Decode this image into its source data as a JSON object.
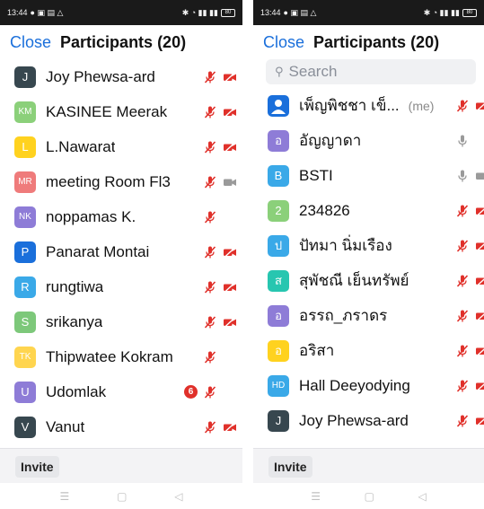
{
  "colors": {
    "accent": "#1a6fdb",
    "muted_red": "#e0302a",
    "status_bar": "#1a1a1a",
    "avatar_darkslate": "#37474f",
    "avatar_green": "#8bd07a",
    "avatar_yellow": "#ffd21f",
    "avatar_salmon": "#ef7b7b",
    "avatar_purple": "#8e7cd7",
    "avatar_blue": "#1a6fdb",
    "avatar_cyan": "#3aa9e8",
    "avatar_lightgreen": "#7dc87a",
    "avatar_lightyellow": "#ffd54f",
    "avatar_violet": "#7e6ad6",
    "avatar_teal": "#27c6b0"
  },
  "left": {
    "status_time": "13:44",
    "status_battery": "80",
    "header": {
      "close_label": "Close",
      "title": "Participants (20)"
    },
    "participants": [
      {
        "initials": "J",
        "name": "Joy Phewsa-ard",
        "color": "#37474f",
        "mic": "muted",
        "cam": "off"
      },
      {
        "initials": "KM",
        "name": "KASINEE Meerak",
        "color": "#8bd07a",
        "mic": "muted",
        "cam": "off"
      },
      {
        "initials": "L",
        "name": "L.Nawarat",
        "color": "#ffd21f",
        "mic": "muted",
        "cam": "off"
      },
      {
        "initials": "MR",
        "name": "meeting Room Fl3",
        "color": "#ef7b7b",
        "mic": "muted",
        "cam": "gray"
      },
      {
        "initials": "NK",
        "name": "noppamas K.",
        "color": "#8e7cd7",
        "mic": "muted",
        "cam": "none"
      },
      {
        "initials": "P",
        "name": "Panarat Montai",
        "color": "#1a6fdb",
        "mic": "muted",
        "cam": "off"
      },
      {
        "initials": "R",
        "name": "rungtiwa",
        "color": "#3aa9e8",
        "mic": "muted",
        "cam": "off"
      },
      {
        "initials": "S",
        "name": "srikanya",
        "color": "#7dc87a",
        "mic": "muted",
        "cam": "off"
      },
      {
        "initials": "TK",
        "name": "Thipwatee Kokram",
        "color": "#ffd54f",
        "mic": "muted",
        "cam": "none"
      },
      {
        "initials": "U",
        "name": "Udomlak",
        "color": "#8e7cd7",
        "mic": "muted",
        "cam": "none",
        "badge": "6"
      },
      {
        "initials": "V",
        "name": "Vanut",
        "color": "#37474f",
        "mic": "muted",
        "cam": "off"
      }
    ],
    "invite_label": "Invite"
  },
  "right": {
    "status_time": "13:44",
    "status_battery": "80",
    "header": {
      "close_label": "Close",
      "title": "Participants (20)"
    },
    "search_placeholder": "Search",
    "participants": [
      {
        "initials": "",
        "name": "เพ็ญพิชชา เข็...",
        "me": "(me)",
        "color": "#1a6fdb",
        "person_icon": true,
        "mic": "muted",
        "cam": "off"
      },
      {
        "initials": "อ",
        "name": "อัญญาดา",
        "color": "#8e7cd7",
        "mic": "gray",
        "cam": "none"
      },
      {
        "initials": "B",
        "name": "BSTI",
        "color": "#3aa9e8",
        "mic": "gray",
        "cam": "gray"
      },
      {
        "initials": "2",
        "name": "234826",
        "color": "#8bd07a",
        "mic": "muted",
        "cam": "off"
      },
      {
        "initials": "ป",
        "name": "ปัทมา นิ่มเรือง",
        "color": "#3aa9e8",
        "mic": "muted",
        "cam": "off"
      },
      {
        "initials": "ส",
        "name": "สุพัชณี เย็นทรัพย์",
        "color": "#27c6b0",
        "mic": "muted",
        "cam": "off"
      },
      {
        "initials": "อ",
        "name": "อรรถ_ภราดร",
        "color": "#8e7cd7",
        "mic": "muted",
        "cam": "off"
      },
      {
        "initials": "อ",
        "name": "อริสา",
        "color": "#ffd21f",
        "mic": "muted",
        "cam": "off"
      },
      {
        "initials": "HD",
        "name": "Hall Deeyodying",
        "color": "#3aa9e8",
        "mic": "muted",
        "cam": "off"
      },
      {
        "initials": "J",
        "name": "Joy Phewsa-ard",
        "color": "#37474f",
        "mic": "muted",
        "cam": "off"
      }
    ],
    "invite_label": "Invite"
  }
}
